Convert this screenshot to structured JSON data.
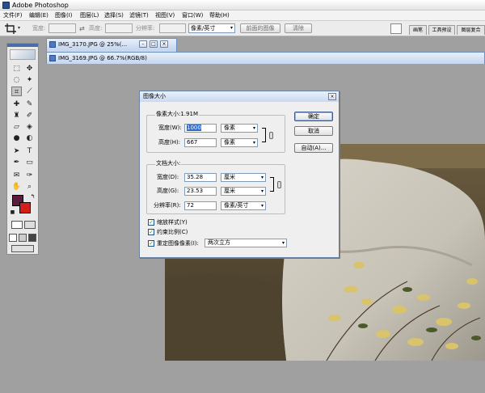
{
  "app": {
    "title": "Adobe Photoshop"
  },
  "menu": [
    "文件(F)",
    "编辑(E)",
    "图像(I)",
    "图层(L)",
    "选择(S)",
    "滤镜(T)",
    "视图(V)",
    "窗口(W)",
    "帮助(H)"
  ],
  "options": {
    "width_label": "宽度:",
    "height_label": "高度:",
    "resolution_label": "分辨率:",
    "unit": "像素/英寸",
    "front_image_button": "前面的图像",
    "clear_button": "清除",
    "palette_tabs": [
      "画笔",
      "工具预设",
      "图层复合"
    ]
  },
  "documents": [
    {
      "title": "IMG_3170.JPG @ 25%(..."
    },
    {
      "title": "IMG_3169.JPG @ 66.7%(RGB/8)"
    }
  ],
  "colors": {
    "foreground": "#5a1e3c",
    "background": "#d41e1e"
  },
  "dialog": {
    "title": "图像大小",
    "pixel_dimensions": {
      "label": "像素大小:1.91M",
      "width_label": "宽度(W):",
      "width_value": "1000",
      "width_unit": "像素",
      "height_label": "高度(H):",
      "height_value": "667",
      "height_unit": "像素"
    },
    "document_size": {
      "label": "文档大小:",
      "width_label": "宽度(D):",
      "width_value": "35.28",
      "width_unit": "厘米",
      "height_label": "高度(G):",
      "height_value": "23.53",
      "height_unit": "厘米",
      "resolution_label": "分辨率(R):",
      "resolution_value": "72",
      "resolution_unit": "像素/英寸"
    },
    "checkboxes": {
      "scale_styles": "缩放样式(Y)",
      "constrain": "约束比例(C)",
      "resample": "重定图像像素(I):"
    },
    "resample_method": "两次立方",
    "buttons": {
      "ok": "确定",
      "cancel": "取消",
      "auto": "自动(A)..."
    }
  }
}
